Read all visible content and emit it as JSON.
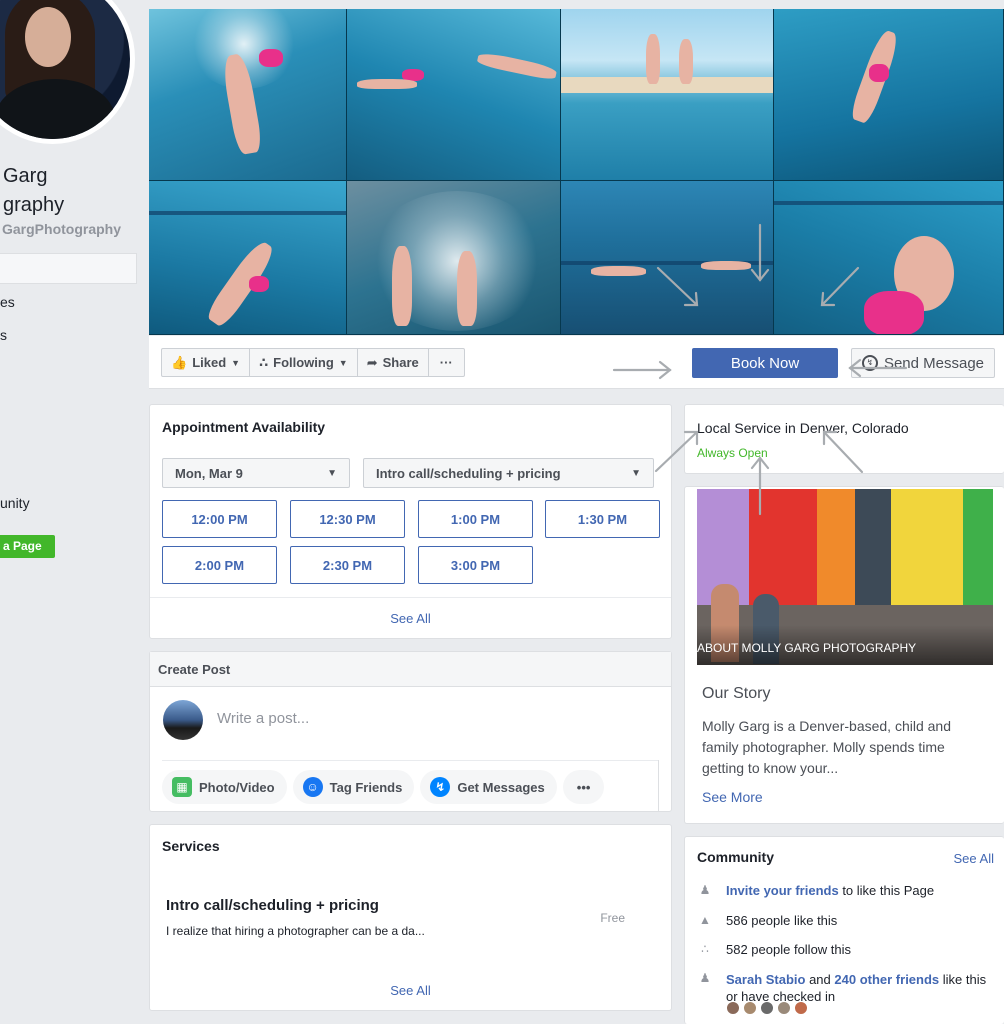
{
  "sidebar": {
    "name_line1": "Garg",
    "name_line2": "graphy",
    "handle": "GargPhotography",
    "links": [
      "es",
      "s",
      "unity"
    ],
    "create_page": "a Page"
  },
  "actions": {
    "liked": "Liked",
    "following": "Following",
    "share": "Share",
    "more": "···",
    "book_now": "Book Now",
    "send_message": "Send Message"
  },
  "appointment": {
    "title": "Appointment Availability",
    "date": "Mon, Mar 9",
    "service": "Intro call/scheduling + pricing",
    "slots": [
      "12:00 PM",
      "12:30 PM",
      "1:00 PM",
      "1:30 PM",
      "2:00 PM",
      "2:30 PM",
      "3:00 PM"
    ],
    "see_all": "See All"
  },
  "create_post": {
    "header": "Create Post",
    "placeholder": "Write a post...",
    "actions": [
      "Photo/Video",
      "Tag Friends",
      "Get Messages"
    ],
    "more": "•••"
  },
  "services": {
    "title": "Services",
    "item_name": "Intro call/scheduling + pricing",
    "item_desc": "I realize that hiring a photographer can be a da...",
    "item_price": "Free",
    "see_all": "See All"
  },
  "local": {
    "category": "Local Service in Denver, Colorado",
    "hours": "Always Open"
  },
  "about": {
    "caption": "ABOUT MOLLY GARG PHOTOGRAPHY",
    "heading": "Our Story",
    "text": "Molly Garg is a Denver-based, child and family photographer. Molly spends time getting to know your...",
    "see_more": "See More"
  },
  "community": {
    "title": "Community",
    "see_all": "See All",
    "invite_link": "Invite your friends",
    "invite_rest": " to like this Page",
    "likes": "586 people like this",
    "follows": "582 people follow this",
    "friend1": "Sarah Stabio",
    "and": " and ",
    "friend_count": "240 other friends",
    "friend_rest": " like this",
    "friend_rest2": "or have checked in"
  },
  "colors": {
    "brand_blue": "#4267b2",
    "green": "#42b72a",
    "background": "#e9ebee"
  }
}
